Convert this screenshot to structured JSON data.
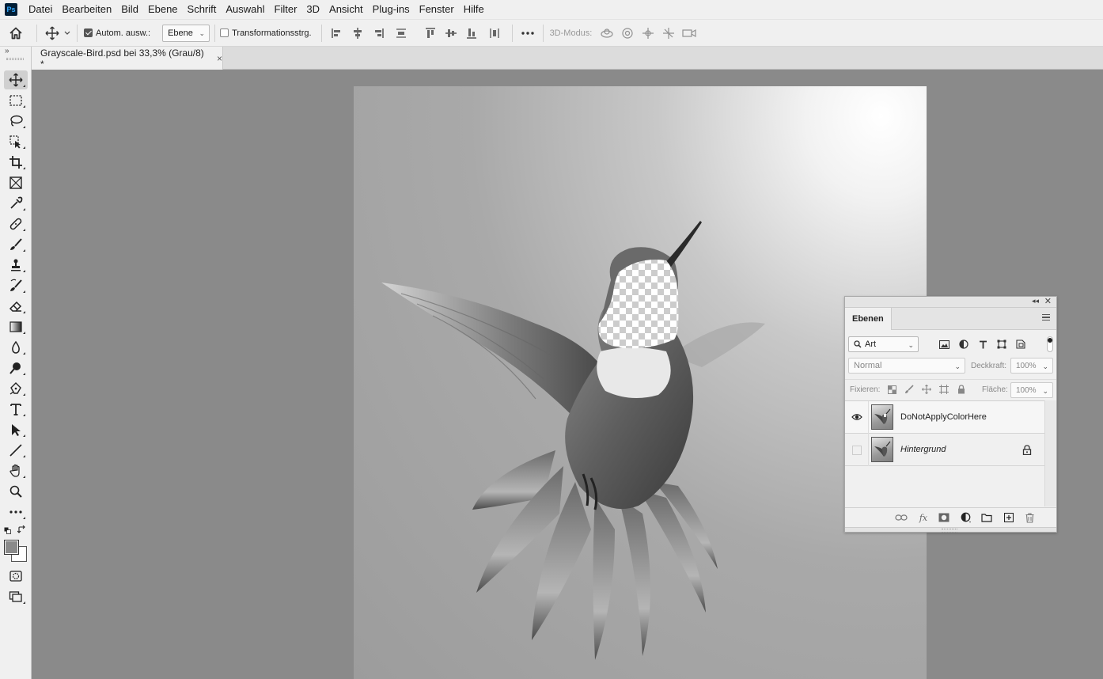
{
  "app": {
    "logo_text": "Ps",
    "menu": [
      "Datei",
      "Bearbeiten",
      "Bild",
      "Ebene",
      "Schrift",
      "Auswahl",
      "Filter",
      "3D",
      "Ansicht",
      "Plug-ins",
      "Fenster",
      "Hilfe"
    ]
  },
  "options": {
    "auto_select_label": "Autom. ausw.:",
    "auto_select_checked": true,
    "auto_select_target": "Ebene",
    "transform_controls_label": "Transformationsstrg.",
    "transform_controls_checked": false,
    "three_d_mode_label": "3D-Modus:"
  },
  "document_tab": {
    "title": "Grayscale-Bird.psd bei 33,3% (Grau/8) *",
    "close": "×"
  },
  "toolbar": {
    "active_tool": "move-tool",
    "foreground_color": "#8a8a8a",
    "background_color": "#ffffff"
  },
  "layers_panel": {
    "tab_label": "Ebenen",
    "filter_kind": "Art",
    "blend_mode": "Normal",
    "opacity_label": "Deckkraft:",
    "opacity_value": "100%",
    "lock_label": "Fixieren:",
    "fill_label": "Fläche:",
    "fill_value": "100%",
    "layers": [
      {
        "name": "DoNotApplyColorHere",
        "visible": true,
        "locked": false,
        "selected": true,
        "italic": false
      },
      {
        "name": "Hintergrund",
        "visible": false,
        "locked": true,
        "selected": false,
        "italic": true
      }
    ],
    "footer_fx": "fx"
  }
}
